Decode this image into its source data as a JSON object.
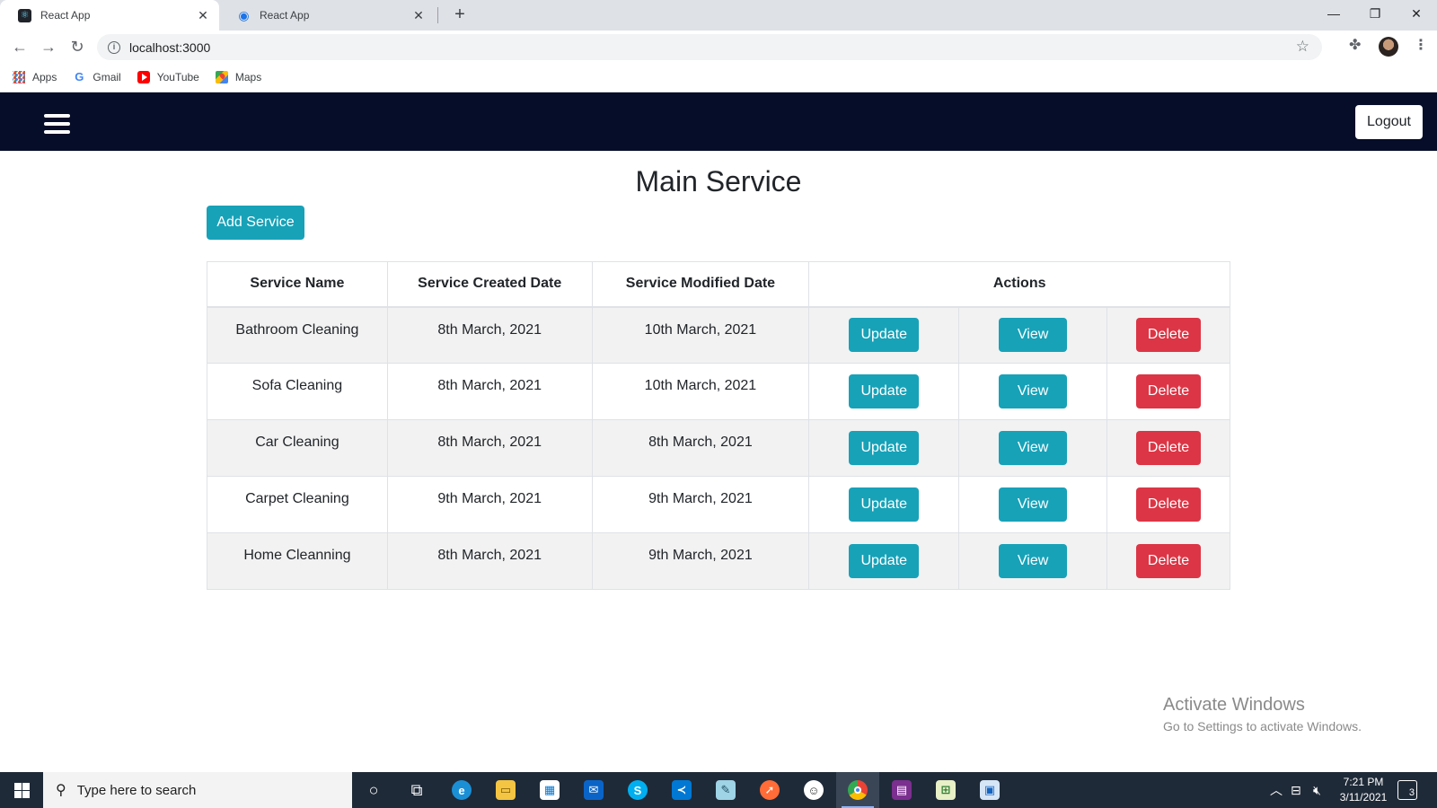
{
  "browser": {
    "tabs": [
      {
        "title": "React App",
        "active": true,
        "icon": "react-icon"
      },
      {
        "title": "React App",
        "active": false,
        "icon": "globe-icon"
      }
    ],
    "url": "localhost:3000",
    "bookmarks": [
      {
        "label": "Apps",
        "icon": "apps-grid-icon"
      },
      {
        "label": "Gmail",
        "icon": "google-icon"
      },
      {
        "label": "YouTube",
        "icon": "youtube-icon"
      },
      {
        "label": "Maps",
        "icon": "maps-icon"
      }
    ]
  },
  "navbar": {
    "logout_label": "Logout",
    "background": "#050d28"
  },
  "main": {
    "title": "Main Service",
    "add_button_label": "Add Service",
    "table": {
      "headers": [
        "Service Name",
        "Service Created Date",
        "Service Modified Date",
        "Actions"
      ],
      "rows": [
        {
          "name": "Bathroom Cleaning",
          "created": "8th March, 2021",
          "modified": "10th March, 2021"
        },
        {
          "name": "Sofa Cleaning",
          "created": "8th March, 2021",
          "modified": "10th March, 2021"
        },
        {
          "name": "Car Cleaning",
          "created": "8th March, 2021",
          "modified": "8th March, 2021"
        },
        {
          "name": "Carpet Cleaning",
          "created": "9th March, 2021",
          "modified": "9th March, 2021"
        },
        {
          "name": "Home Cleanning",
          "created": "8th March, 2021",
          "modified": "9th March, 2021"
        }
      ],
      "action_labels": {
        "update": "Update",
        "view": "View",
        "delete": "Delete"
      }
    }
  },
  "watermark": {
    "line1": "Activate Windows",
    "line2": "Go to Settings to activate Windows."
  },
  "taskbar": {
    "search_placeholder": "Type here to search",
    "time": "7:21 PM",
    "date": "3/11/2021",
    "notification_count": "3"
  },
  "colors": {
    "info": "#17a2b8",
    "danger": "#dc3545",
    "stripe": "#f2f2f2"
  }
}
